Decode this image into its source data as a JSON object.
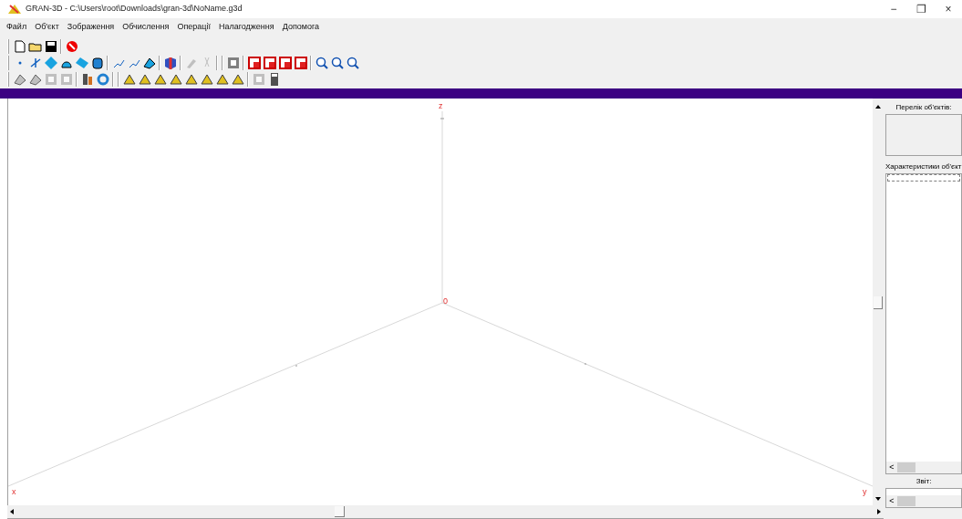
{
  "window": {
    "title": "GRAN-3D - C:\\Users\\root\\Downloads\\gran-3d\\NoName.g3d",
    "controls": [
      "−",
      "❐",
      "×"
    ]
  },
  "menu": [
    "Файл",
    "Об'єкт",
    "Зображення",
    "Обчислення",
    "Операції",
    "Налагодження",
    "Допомога"
  ],
  "toolbars": [
    [
      {
        "disabled": false
      },
      {
        "disabled": false
      },
      {
        "disabled": false
      },
      {
        "kind": "separator"
      },
      {
        "disabled": false
      }
    ],
    [
      {
        "disabled": false
      },
      {
        "disabled": false
      },
      {
        "disabled": false
      },
      {
        "disabled": false
      },
      {
        "disabled": false
      },
      {
        "disabled": false
      },
      {
        "kind": "separator"
      },
      {
        "disabled": false
      },
      {
        "disabled": false
      },
      {
        "disabled": false
      },
      {
        "kind": "separator"
      },
      {
        "disabled": false
      },
      {
        "kind": "separator"
      },
      {
        "disabled": true
      },
      {
        "disabled": true
      },
      {
        "kind": "separator"
      },
      {
        "kind": "separator"
      },
      {
        "disabled": false
      },
      {
        "kind": "separator"
      },
      {
        "disabled": false
      },
      {
        "disabled": false
      },
      {
        "disabled": false
      },
      {
        "disabled": false
      },
      {
        "kind": "separator"
      },
      {
        "disabled": false
      },
      {
        "disabled": false
      },
      {
        "disabled": false
      }
    ],
    [
      {
        "disabled": true
      },
      {
        "disabled": true
      },
      {
        "disabled": true
      },
      {
        "disabled": true
      },
      {
        "kind": "separator"
      },
      {
        "disabled": false
      },
      {
        "disabled": false
      },
      {
        "kind": "separator"
      },
      {
        "kind": "separator"
      },
      {
        "disabled": false
      },
      {
        "disabled": false
      },
      {
        "disabled": false
      },
      {
        "disabled": false
      },
      {
        "disabled": false
      },
      {
        "disabled": false
      },
      {
        "disabled": false
      },
      {
        "disabled": false
      },
      {
        "kind": "separator"
      },
      {
        "disabled": true
      },
      {
        "disabled": false
      }
    ]
  ],
  "canvas": {
    "axis_labels": {
      "z": "z",
      "origin": "0",
      "x": "x",
      "y": "y"
    }
  },
  "side_panel": {
    "objects_label": "Перелік об'єктів:",
    "properties_label": "Характеристики об'єкт",
    "report_label": "Звіт:",
    "scroll_left": [
      "<",
      "<"
    ]
  }
}
